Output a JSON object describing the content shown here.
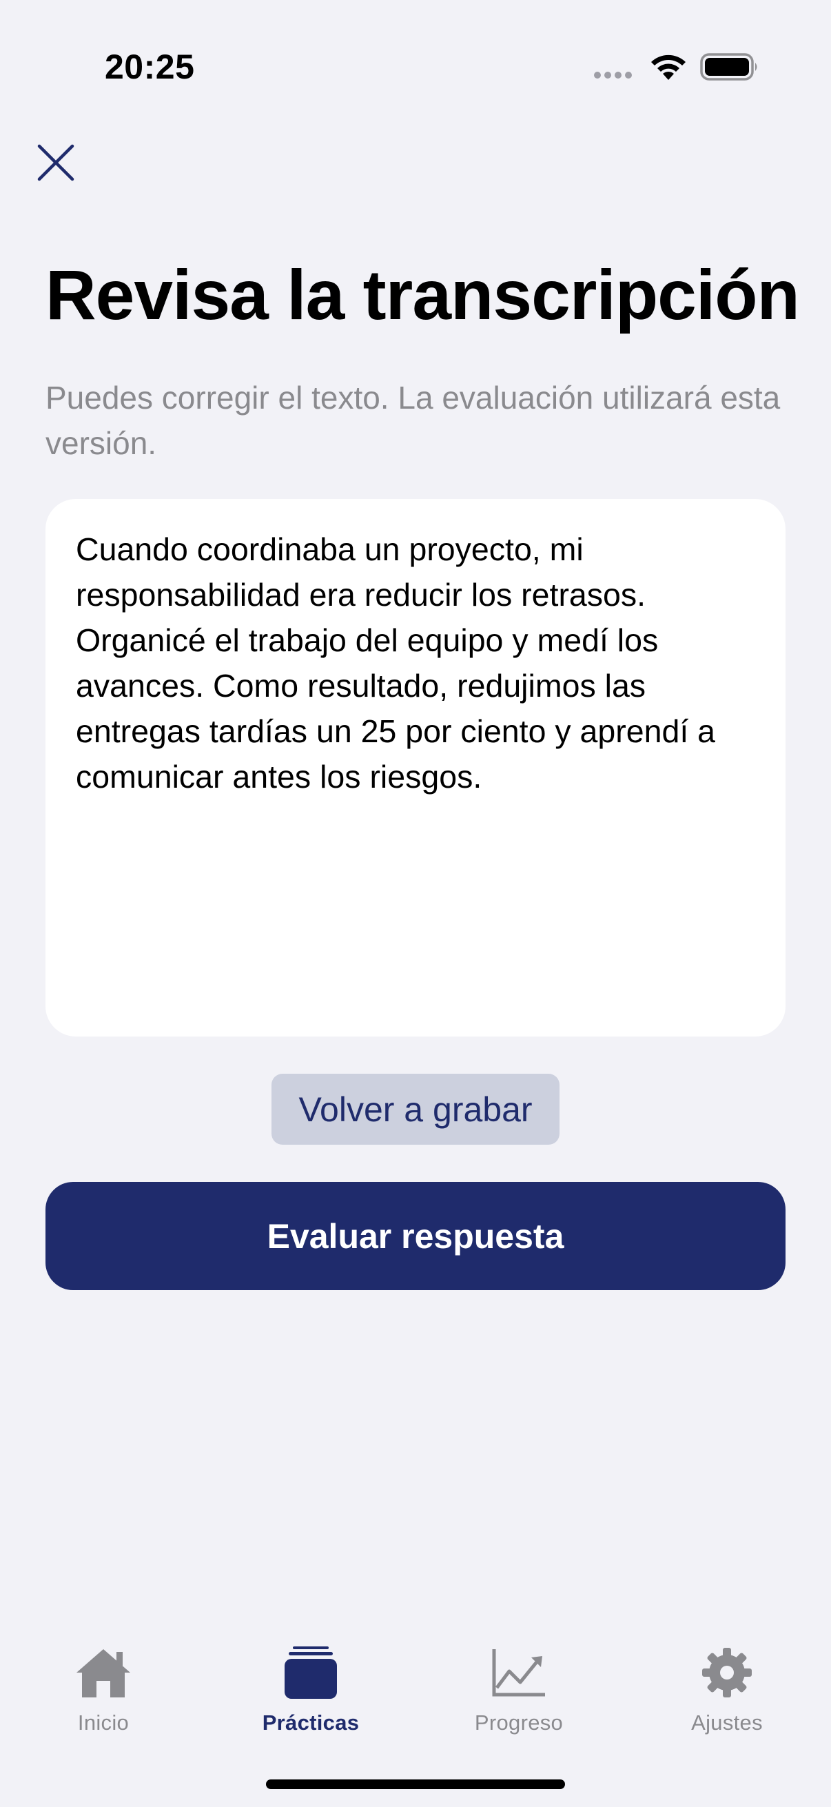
{
  "status_bar": {
    "time": "20:25"
  },
  "header": {
    "close_icon": "close-icon"
  },
  "page": {
    "title": "Revisa la transcripción",
    "subtitle": "Puedes corregir el texto. La evaluación utilizará esta versión."
  },
  "transcript": {
    "text": "Cuando coordinaba un proyecto, mi responsabilidad era reducir los retrasos. Organicé el trabajo del equipo y medí los avances. Como resultado, redujimos las entregas tardías un 25 por ciento y aprendí a comunicar antes los riesgos."
  },
  "actions": {
    "rerecord_label": "Volver a grabar",
    "evaluate_label": "Evaluar respuesta"
  },
  "tab_bar": {
    "active": "Prácticas",
    "items": [
      {
        "label": "Inicio",
        "icon": "house-icon"
      },
      {
        "label": "Prácticas",
        "icon": "stack-icon"
      },
      {
        "label": "Progreso",
        "icon": "chart-icon"
      },
      {
        "label": "Ajustes",
        "icon": "gear-icon"
      }
    ]
  },
  "colors": {
    "accent": "#1f2b6c",
    "background": "#f2f2f7",
    "secondary_text": "#8a8a8e",
    "rerecord_bg": "#ccd0de"
  }
}
